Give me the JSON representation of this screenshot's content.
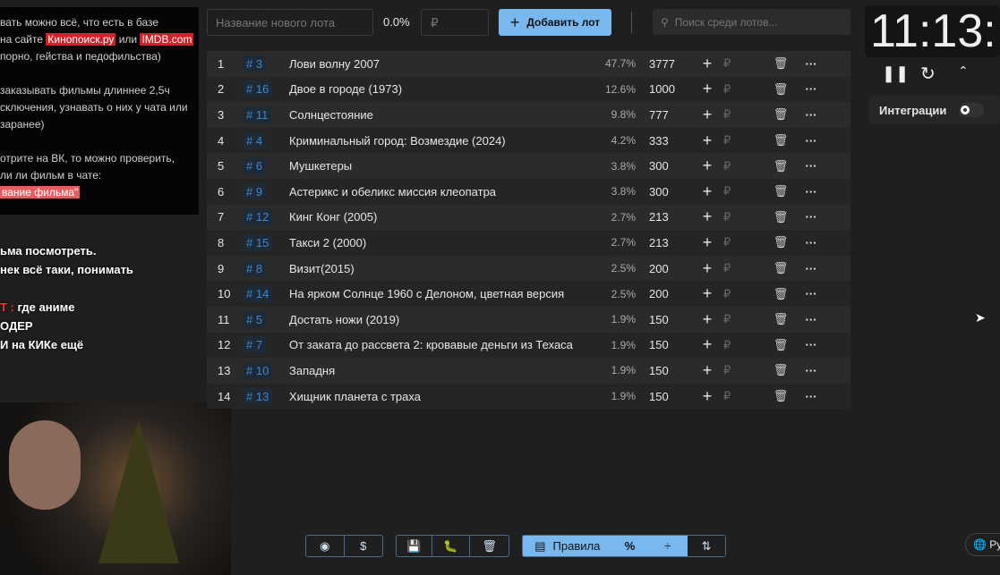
{
  "rules_panel": {
    "lines": [
      [
        "вать можно всё, что есть в базе"
      ],
      [
        "на сайте ",
        "Кинопоиск.ру",
        " или ",
        "IMDB.com"
      ],
      [
        "порно, гейства и педофильства)"
      ],
      [
        ""
      ],
      [
        "заказывать фильмы длиннее 2,5ч"
      ],
      [
        "сключения, узнавать о них у чата или"
      ],
      [
        "заранее)"
      ],
      [
        ""
      ],
      [
        "отрите на ВК, то можно проверить,"
      ],
      [
        "ли ли фильм в чате:"
      ],
      [
        "вание фильма\""
      ]
    ]
  },
  "chat": [
    "ьма посмотреть.",
    "нек всё таки, понимать",
    "",
    "Т : где аниме",
    "ОДЕР",
    "И на КИКе ещё"
  ],
  "chat_red": [
    "Т :"
  ],
  "toolbar": {
    "name_placeholder": "Название нового лота",
    "percent": "0.0%",
    "rub_placeholder": "₽",
    "add_label": "Добавить лот",
    "search_placeholder": "Поиск среди лотов..."
  },
  "lots": [
    {
      "n": "1",
      "id": "# 3",
      "title": "Лови волну 2007",
      "pct": "47.7%",
      "amount": "3777"
    },
    {
      "n": "2",
      "id": "# 16",
      "title": "Двое в городе (1973)",
      "pct": "12.6%",
      "amount": "1000"
    },
    {
      "n": "3",
      "id": "# 11",
      "title": "Солнцестояние",
      "pct": "9.8%",
      "amount": "777"
    },
    {
      "n": "4",
      "id": "# 4",
      "title": "Криминальный город: Возмездие (2024)",
      "pct": "4.2%",
      "amount": "333"
    },
    {
      "n": "5",
      "id": "# 6",
      "title": "Мушкетеры",
      "pct": "3.8%",
      "amount": "300"
    },
    {
      "n": "6",
      "id": "# 9",
      "title": "Астерикс и обеликс миссия клеопатра",
      "pct": "3.8%",
      "amount": "300"
    },
    {
      "n": "7",
      "id": "# 12",
      "title": "Кинг Конг (2005)",
      "pct": "2.7%",
      "amount": "213"
    },
    {
      "n": "8",
      "id": "# 15",
      "title": "Такси 2 (2000)",
      "pct": "2.7%",
      "amount": "213"
    },
    {
      "n": "9",
      "id": "# 8",
      "title": "Визит(2015)",
      "pct": "2.5%",
      "amount": "200"
    },
    {
      "n": "10",
      "id": "# 14",
      "title": "На ярком Солнце 1960 с Делоном, цветная версия",
      "pct": "2.5%",
      "amount": "200"
    },
    {
      "n": "11",
      "id": "# 5",
      "title": "Достать ножи (2019)",
      "pct": "1.9%",
      "amount": "150"
    },
    {
      "n": "12",
      "id": "# 7",
      "title": "От заката до рассвета 2: кровавые деньги из Техаса",
      "pct": "1.9%",
      "amount": "150"
    },
    {
      "n": "13",
      "id": "# 10",
      "title": "Западня",
      "pct": "1.9%",
      "amount": "150"
    },
    {
      "n": "14",
      "id": "# 13",
      "title": "Хищник планета с траха",
      "pct": "1.9%",
      "amount": "150"
    }
  ],
  "row_labels": {
    "plus": "+",
    "rub": "₽",
    "delete": "🗑",
    "more": "···"
  },
  "timer": {
    "time": "11:13:",
    "integrations_label": "Интеграции",
    "integrations_on": false
  },
  "bottom": {
    "rules_label": "Правила",
    "dollar": "$",
    "percent": "%",
    "lang": "Ру"
  },
  "colors": {
    "accent": "#79b8ef",
    "id_blue": "#3f86d0",
    "highlight_red": "#d0202a"
  }
}
